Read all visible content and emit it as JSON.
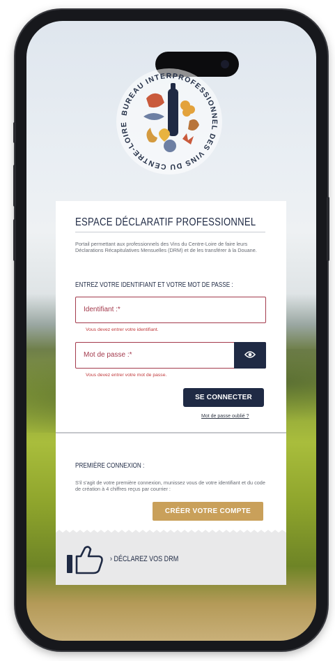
{
  "logo": {
    "ring_text": "BUREAU INTERPROFESSIONNEL DES VINS DU CENTRE-LOIRE"
  },
  "card": {
    "title": "ESPACE DÉCLARATIF PROFESSIONNEL",
    "intro": "Portail permettant aux professionnels des Vins du Centre-Loire de faire leurs Déclarations Récapitulatives Mensuelles (DRM) et de les transférer à la Douane.",
    "credentials_label": "ENTREZ VOTRE IDENTIFIANT ET VOTRE MOT DE PASSE :",
    "identifiant": {
      "placeholder": "Identifiant :*",
      "value": "",
      "error": "Vous devez entrer votre identifiant."
    },
    "password": {
      "placeholder": "Mot de passe :*",
      "value": "",
      "error": "Vous devez entrer votre mot de passe."
    },
    "connect_label": "SE CONNECTER",
    "forgot_label": "Mot de passe oublié ?",
    "first_login_label": "PREMIÈRE CONNEXION :",
    "first_login_text": "S'il s'agit de votre première connexion, munissez vous de votre identifiant et du code de création à 4 chiffres reçus par courrier :",
    "create_account_label": "CRÉER VOTRE COMPTE",
    "banner_text": "› DÉCLAREZ VOS DRM"
  },
  "icons": {
    "password_toggle": "eye-icon",
    "banner": "thumbs-up-icon"
  },
  "colors": {
    "navy": "#1f2a44",
    "error_red": "#a33a4c",
    "gold": "#c9a05a"
  }
}
